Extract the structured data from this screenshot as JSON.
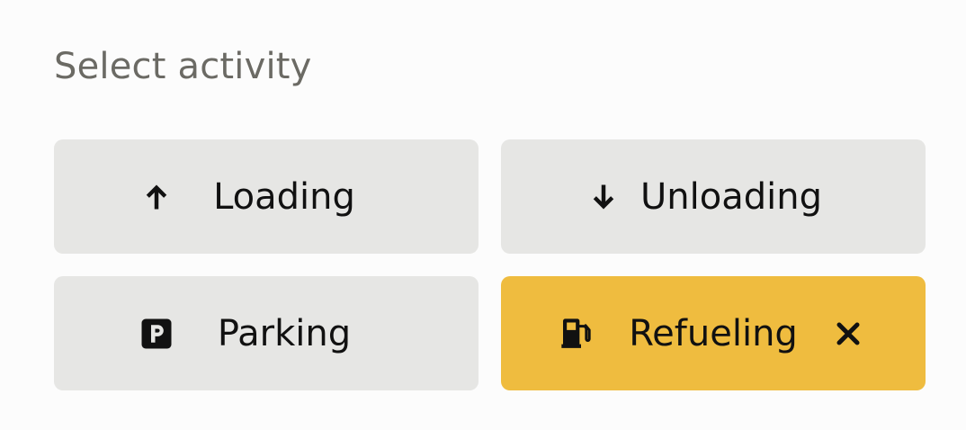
{
  "heading": "Select activity",
  "activities": [
    {
      "label": "Loading",
      "icon": "arrow-up-icon",
      "selected": false
    },
    {
      "label": "Unloading",
      "icon": "arrow-down-icon",
      "selected": false
    },
    {
      "label": "Parking",
      "icon": "parking-icon",
      "selected": false
    },
    {
      "label": "Refueling",
      "icon": "fuel-pump-icon",
      "selected": true,
      "clear_icon": "close-icon"
    }
  ],
  "colors": {
    "button_bg": "#e6e6e4",
    "selected_bg": "#efbc3f",
    "heading_text": "#6b6a64",
    "text": "#111111"
  }
}
